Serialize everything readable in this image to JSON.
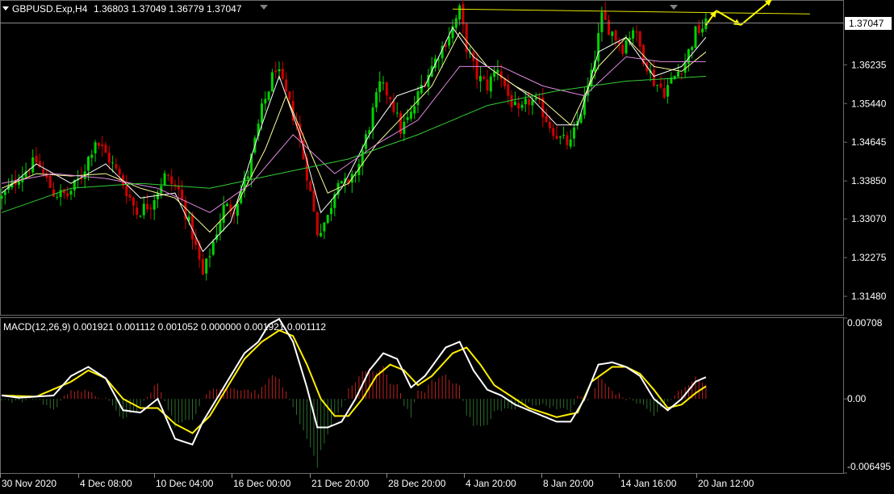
{
  "header": {
    "symbol_text": "GBPUSD.Exp,H4",
    "ohlc_text": "1.36803 1.37049 1.36779 1.37047"
  },
  "price_axis": {
    "labels": [
      "1.36235",
      "1.35440",
      "1.34645",
      "1.33850",
      "1.33070",
      "1.32275",
      "1.31480"
    ],
    "current_label": "1.37047"
  },
  "macd_panel": {
    "title_text": "MACD(12,26,9) 0.001921 0.001112 0.001052 0.000000 0.001921 0.001112",
    "axis_labels": [
      "0.00708",
      "0.00",
      "-0.006495"
    ]
  },
  "time_axis": {
    "labels": [
      "30 Nov 2020",
      "4 Dec 08:00",
      "10 Dec 04:00",
      "16 Dec 00:00",
      "21 Dec 20:00",
      "28 Dec 20:00",
      "4 Jan 20:00",
      "8 Jan 20:00",
      "14 Jan 16:00",
      "20 Jan 12:00"
    ]
  },
  "colors": {
    "background": "#000000",
    "bull_candle": "#00d200",
    "bear_candle": "#d20000",
    "ma_fast": "#ffffff",
    "ma_mid": "#ffff99",
    "ma_slow": "#dd88dd",
    "ma_long": "#33cc33",
    "macd_line": "#ffffff",
    "signal_line": "#ffee00",
    "hist_pos": "#c02020",
    "hist_neg": "#2d6e2d",
    "trend_line": "#e6e600",
    "arrow": "#ffff00",
    "grid": "#6b6b6b"
  },
  "chart_data": {
    "type": "candlestick",
    "title": "GBPUSD.Exp,H4",
    "y_range": [
      1.311,
      1.3755
    ],
    "close_path": [
      [
        0,
        1.335
      ],
      [
        5,
        1.3395
      ],
      [
        10,
        1.3425
      ],
      [
        15,
        1.336
      ],
      [
        19,
        1.3355
      ],
      [
        23,
        1.3395
      ],
      [
        27,
        1.347
      ],
      [
        31,
        1.343
      ],
      [
        35,
        1.338
      ],
      [
        39,
        1.332
      ],
      [
        43,
        1.334
      ],
      [
        47,
        1.3395
      ],
      [
        51,
        1.3365
      ],
      [
        55,
        1.3275
      ],
      [
        58,
        1.319
      ],
      [
        61,
        1.326
      ],
      [
        64,
        1.333
      ],
      [
        67,
        1.333
      ],
      [
        71,
        1.34
      ],
      [
        75,
        1.353
      ],
      [
        79,
        1.362
      ],
      [
        82,
        1.356
      ],
      [
        85,
        1.35
      ],
      [
        88,
        1.34
      ],
      [
        91,
        1.328
      ],
      [
        94,
        1.331
      ],
      [
        97,
        1.3395
      ],
      [
        100,
        1.337
      ],
      [
        103,
        1.342
      ],
      [
        106,
        1.35
      ],
      [
        109,
        1.358
      ],
      [
        112,
        1.356
      ],
      [
        115,
        1.349
      ],
      [
        118,
        1.352
      ],
      [
        121,
        1.358
      ],
      [
        124,
        1.362
      ],
      [
        127,
        1.366
      ],
      [
        130,
        1.37
      ],
      [
        132,
        1.3735
      ],
      [
        134,
        1.366
      ],
      [
        137,
        1.36
      ],
      [
        140,
        1.358
      ],
      [
        143,
        1.362
      ],
      [
        146,
        1.356
      ],
      [
        149,
        1.352
      ],
      [
        152,
        1.355
      ],
      [
        155,
        1.354
      ],
      [
        158,
        1.35
      ],
      [
        161,
        1.347
      ],
      [
        164,
        1.346
      ],
      [
        167,
        1.353
      ],
      [
        170,
        1.36
      ],
      [
        173,
        1.372
      ],
      [
        176,
        1.369
      ],
      [
        179,
        1.366
      ],
      [
        182,
        1.37
      ],
      [
        185,
        1.364
      ],
      [
        188,
        1.359
      ],
      [
        191,
        1.357
      ],
      [
        194,
        1.36
      ],
      [
        197,
        1.363
      ],
      [
        200,
        1.369
      ],
      [
        203,
        1.3705
      ]
    ],
    "moving_averages": [
      {
        "points": [
          [
            0,
            1.336
          ],
          [
            10,
            1.342
          ],
          [
            20,
            1.338
          ],
          [
            30,
            1.342
          ],
          [
            40,
            1.335
          ],
          [
            50,
            1.336
          ],
          [
            58,
            1.324
          ],
          [
            66,
            1.33
          ],
          [
            74,
            1.348
          ],
          [
            80,
            1.36
          ],
          [
            86,
            1.348
          ],
          [
            92,
            1.332
          ],
          [
            98,
            1.337
          ],
          [
            106,
            1.348
          ],
          [
            114,
            1.356
          ],
          [
            122,
            1.358
          ],
          [
            130,
            1.37
          ],
          [
            136,
            1.364
          ],
          [
            144,
            1.36
          ],
          [
            152,
            1.356
          ],
          [
            160,
            1.35
          ],
          [
            166,
            1.35
          ],
          [
            172,
            1.365
          ],
          [
            180,
            1.368
          ],
          [
            188,
            1.36
          ],
          [
            196,
            1.362
          ],
          [
            203,
            1.368
          ]
        ]
      },
      {
        "points": [
          [
            0,
            1.337
          ],
          [
            10,
            1.34
          ],
          [
            20,
            1.3395
          ],
          [
            30,
            1.34
          ],
          [
            40,
            1.337
          ],
          [
            50,
            1.335
          ],
          [
            60,
            1.328
          ],
          [
            68,
            1.334
          ],
          [
            76,
            1.345
          ],
          [
            82,
            1.356
          ],
          [
            88,
            1.346
          ],
          [
            94,
            1.336
          ],
          [
            100,
            1.338
          ],
          [
            108,
            1.346
          ],
          [
            116,
            1.352
          ],
          [
            124,
            1.358
          ],
          [
            132,
            1.369
          ],
          [
            140,
            1.362
          ],
          [
            148,
            1.358
          ],
          [
            156,
            1.355
          ],
          [
            164,
            1.35
          ],
          [
            172,
            1.362
          ],
          [
            180,
            1.368
          ],
          [
            188,
            1.362
          ],
          [
            196,
            1.361
          ],
          [
            203,
            1.365
          ]
        ]
      },
      {
        "points": [
          [
            0,
            1.338
          ],
          [
            15,
            1.34
          ],
          [
            30,
            1.339
          ],
          [
            45,
            1.337
          ],
          [
            60,
            1.332
          ],
          [
            72,
            1.338
          ],
          [
            84,
            1.348
          ],
          [
            96,
            1.34
          ],
          [
            108,
            1.346
          ],
          [
            120,
            1.351
          ],
          [
            132,
            1.362
          ],
          [
            144,
            1.362
          ],
          [
            156,
            1.358
          ],
          [
            168,
            1.356
          ],
          [
            180,
            1.364
          ],
          [
            190,
            1.363
          ],
          [
            203,
            1.363
          ]
        ]
      },
      {
        "points": [
          [
            0,
            1.332
          ],
          [
            20,
            1.337
          ],
          [
            40,
            1.338
          ],
          [
            60,
            1.337
          ],
          [
            80,
            1.34
          ],
          [
            100,
            1.343
          ],
          [
            120,
            1.348
          ],
          [
            140,
            1.354
          ],
          [
            160,
            1.357
          ],
          [
            180,
            1.359
          ],
          [
            203,
            1.36
          ]
        ]
      }
    ],
    "trend_line": [
      [
        130,
        1.3738
      ],
      [
        233,
        1.3728
      ]
    ],
    "projection_arrow": [
      [
        203,
        1.3705
      ],
      [
        206,
        1.3735
      ],
      [
        213,
        1.3705
      ],
      [
        222,
        1.3758
      ]
    ],
    "macd": {
      "y_range": [
        -0.006495,
        0.00708
      ],
      "macd_line": [
        [
          0,
          0.0003
        ],
        [
          5,
          0.0001
        ],
        [
          10,
          0.0002
        ],
        [
          15,
          0.0003
        ],
        [
          20,
          0.002
        ],
        [
          25,
          0.0028
        ],
        [
          30,
          0.0018
        ],
        [
          35,
          -0.001
        ],
        [
          40,
          -0.0012
        ],
        [
          45,
          0.0
        ],
        [
          50,
          -0.0035
        ],
        [
          55,
          -0.004
        ],
        [
          58,
          -0.002
        ],
        [
          62,
          0.0
        ],
        [
          66,
          0.002
        ],
        [
          70,
          0.004
        ],
        [
          74,
          0.005
        ],
        [
          77,
          0.0065
        ],
        [
          80,
          0.007
        ],
        [
          84,
          0.005
        ],
        [
          88,
          0.001
        ],
        [
          91,
          -0.0025
        ],
        [
          94,
          -0.0025
        ],
        [
          98,
          -0.002
        ],
        [
          102,
          0.0
        ],
        [
          106,
          0.0025
        ],
        [
          110,
          0.004
        ],
        [
          114,
          0.0035
        ],
        [
          118,
          0.001
        ],
        [
          122,
          0.002
        ],
        [
          128,
          0.0045
        ],
        [
          132,
          0.005
        ],
        [
          136,
          0.0025
        ],
        [
          140,
          0.0008
        ],
        [
          144,
          0.0003
        ],
        [
          148,
          -0.0005
        ],
        [
          152,
          -0.001
        ],
        [
          156,
          -0.0015
        ],
        [
          160,
          -0.002
        ],
        [
          164,
          -0.002
        ],
        [
          168,
          0.0
        ],
        [
          172,
          0.003
        ],
        [
          176,
          0.0032
        ],
        [
          180,
          0.0028
        ],
        [
          184,
          0.002
        ],
        [
          188,
          0.0
        ],
        [
          192,
          -0.001
        ],
        [
          196,
          0.0
        ],
        [
          200,
          0.0015
        ],
        [
          203,
          0.0019
        ]
      ],
      "signal_line": [
        [
          0,
          0.0003
        ],
        [
          10,
          0.0002
        ],
        [
          20,
          0.0015
        ],
        [
          25,
          0.0025
        ],
        [
          30,
          0.0018
        ],
        [
          35,
          0.0
        ],
        [
          40,
          -0.0008
        ],
        [
          45,
          -0.0008
        ],
        [
          50,
          -0.0022
        ],
        [
          55,
          -0.003
        ],
        [
          60,
          -0.0015
        ],
        [
          65,
          0.001
        ],
        [
          70,
          0.0035
        ],
        [
          75,
          0.005
        ],
        [
          80,
          0.006
        ],
        [
          84,
          0.0055
        ],
        [
          88,
          0.003
        ],
        [
          92,
          0.0
        ],
        [
          96,
          -0.0015
        ],
        [
          100,
          -0.0015
        ],
        [
          104,
          0.0
        ],
        [
          108,
          0.002
        ],
        [
          112,
          0.003
        ],
        [
          116,
          0.0025
        ],
        [
          120,
          0.0012
        ],
        [
          124,
          0.002
        ],
        [
          130,
          0.004
        ],
        [
          134,
          0.0045
        ],
        [
          138,
          0.003
        ],
        [
          142,
          0.0012
        ],
        [
          148,
          0.0
        ],
        [
          152,
          -0.0008
        ],
        [
          156,
          -0.0012
        ],
        [
          160,
          -0.0016
        ],
        [
          166,
          -0.0012
        ],
        [
          170,
          0.0015
        ],
        [
          176,
          0.0028
        ],
        [
          180,
          0.0028
        ],
        [
          184,
          0.0022
        ],
        [
          188,
          0.0008
        ],
        [
          192,
          -0.0008
        ],
        [
          196,
          -0.0005
        ],
        [
          200,
          0.0005
        ],
        [
          203,
          0.0011
        ]
      ]
    },
    "x_tick_labels": [
      "30 Nov 2020",
      "4 Dec 08:00",
      "10 Dec 04:00",
      "16 Dec 00:00",
      "21 Dec 20:00",
      "28 Dec 20:00",
      "4 Jan 20:00",
      "8 Jan 20:00",
      "14 Jan 16:00",
      "20 Jan 12:00"
    ],
    "y_tick_labels": [
      "1.36235",
      "1.35440",
      "1.34645",
      "1.33850",
      "1.33070",
      "1.32275",
      "1.31480"
    ]
  }
}
